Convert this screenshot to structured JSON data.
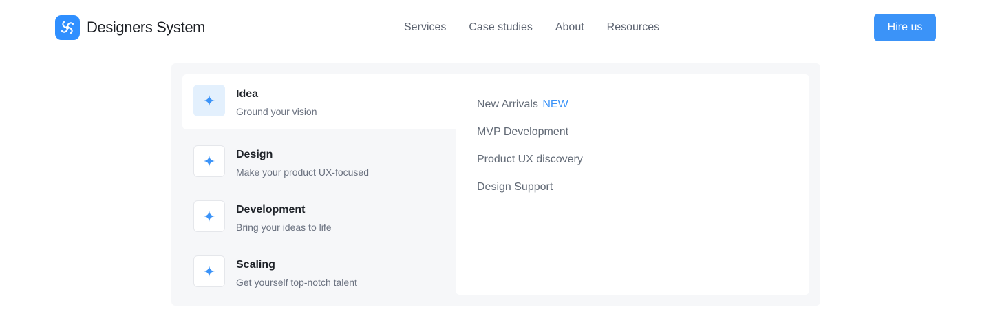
{
  "brand": {
    "name": "Designers System",
    "logo_icon": "swirl-logo-icon",
    "accent_color": "#3b93f8"
  },
  "nav": [
    {
      "label": "Services"
    },
    {
      "label": "Case studies"
    },
    {
      "label": "About"
    },
    {
      "label": "Resources"
    }
  ],
  "cta": {
    "label": "Hire us"
  },
  "menu": {
    "categories": [
      {
        "title": "Idea",
        "description": "Ground your vision",
        "icon": "sparkle-icon",
        "active": true
      },
      {
        "title": "Design",
        "description": "Make your product UX-focused",
        "icon": "sparkle-icon",
        "active": false
      },
      {
        "title": "Development",
        "description": "Bring your ideas to life",
        "icon": "sparkle-icon",
        "active": false
      },
      {
        "title": "Scaling",
        "description": "Get yourself top-notch talent",
        "icon": "sparkle-icon",
        "active": false
      }
    ],
    "links": [
      {
        "label": "New Arrivals",
        "badge": "NEW"
      },
      {
        "label": "MVP Development"
      },
      {
        "label": "Product UX discovery"
      },
      {
        "label": "Design Support"
      }
    ]
  }
}
